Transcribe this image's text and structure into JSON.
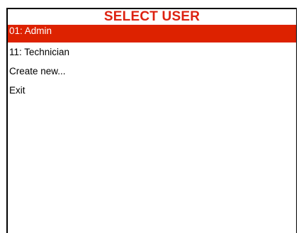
{
  "title": "SELECT USER",
  "colors": {
    "title": "#dd2211",
    "selection_background": "#dd2200",
    "selection_text": "#ffffff"
  },
  "menu": {
    "selected_index": 0,
    "items": [
      {
        "label": "01: Admin"
      },
      {
        "label": "11: Technician"
      },
      {
        "label": "Create new..."
      },
      {
        "label": "Exit"
      }
    ]
  }
}
